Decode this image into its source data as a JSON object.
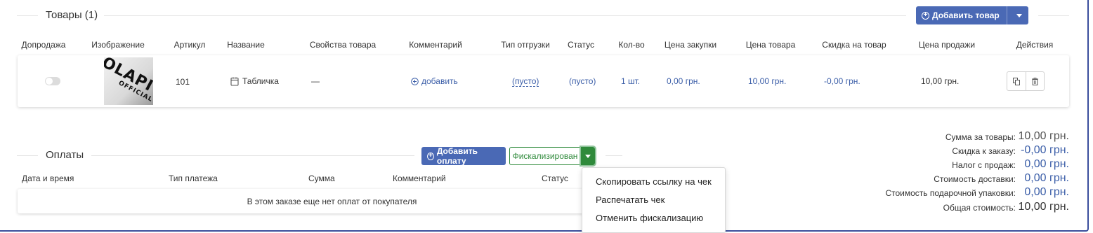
{
  "products": {
    "title": "Товары (1)",
    "add_button_label": "Добавить товар",
    "columns": [
      "Допродажа",
      "Изображение",
      "Артикул",
      "Название",
      "Свойства товара",
      "Комментарий",
      "Тип отгрузки",
      "Статус",
      "Кол-во",
      "Цена закупки",
      "Цена товара",
      "Скидка на товар",
      "Цена продажи",
      "Действия"
    ],
    "row": {
      "upsell_toggle": false,
      "image_brand": "OLAPI",
      "image_brand_sub": "OFFICIAL",
      "article": "101",
      "name": "Табличка",
      "properties": "—",
      "comment_link": "добавить",
      "shipping_type": "(пусто)",
      "status": "(пусто)",
      "quantity": "1 шт.",
      "purchase_price": "0,00 грн.",
      "product_price": "10,00 грн.",
      "discount": "-0,00 грн.",
      "sale_price": "10,00 грн."
    }
  },
  "payments": {
    "title": "Оплаты",
    "add_button_label": "Добавить оплату",
    "fiscal_button_label": "Фискализирован",
    "columns": [
      "Дата и время",
      "Тип платежа",
      "Сумма",
      "Комментарий",
      "Статус"
    ],
    "empty_text": "В этом заказе еще нет оплат от покупателя"
  },
  "dropdown": {
    "items": [
      "Скопировать ссылку на чек",
      "Распечатать чек",
      "Отменить фискализацию"
    ]
  },
  "summary": {
    "rows": [
      {
        "label": "Сумма за товары:",
        "value": "10,00 грн.",
        "color": "#555555"
      },
      {
        "label": "Скидка к заказу:",
        "value": "-0,00 грн.",
        "color": "#3b5ea8"
      },
      {
        "label": "Налог с продаж:",
        "value": "0,00 грн.",
        "color": "#3b5ea8"
      },
      {
        "label": "Стоимость доставки:",
        "value": "0,00 грн.",
        "color": "#3b5ea8"
      },
      {
        "label": "Стоимость подарочной упаковки:",
        "value": "0,00 грн.",
        "color": "#3b5ea8"
      },
      {
        "label": "Общая стоимость:",
        "value": "10,00 грн.",
        "color": "#333333"
      }
    ]
  },
  "colors": {
    "primary": "#4a69b5",
    "success": "#2f8a3b",
    "link": "#3b5ea8",
    "frame": "#3b4e9c"
  }
}
